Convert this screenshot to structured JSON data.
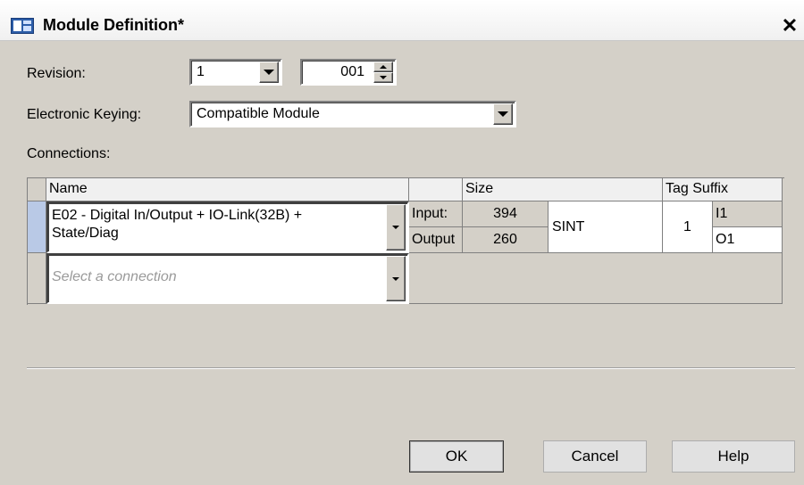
{
  "window": {
    "title": "Module Definition*"
  },
  "revision": {
    "label": "Revision:",
    "major": "1",
    "minor": "001"
  },
  "keying": {
    "label": "Electronic Keying:",
    "value": "Compatible Module"
  },
  "connections": {
    "label": "Connections:",
    "headers": {
      "name": "Name",
      "size": "Size",
      "tag_suffix": "Tag Suffix"
    },
    "row": {
      "name_line1": "E02 - Digital In/Output + IO-Link(32B) +",
      "name_line2": "State/Diag",
      "input_label": "Input:",
      "input_size": "394",
      "output_label": "Output",
      "output_size": "260",
      "data_type": "SINT",
      "slot": "1",
      "input_suffix": "I1",
      "output_suffix": "O1"
    },
    "empty_row_placeholder": "Select a connection"
  },
  "buttons": {
    "ok": "OK",
    "cancel": "Cancel",
    "help": "Help"
  },
  "colors": {
    "dialog_bg": "#d4d0c8",
    "selection_row": "#b9c9e6"
  }
}
